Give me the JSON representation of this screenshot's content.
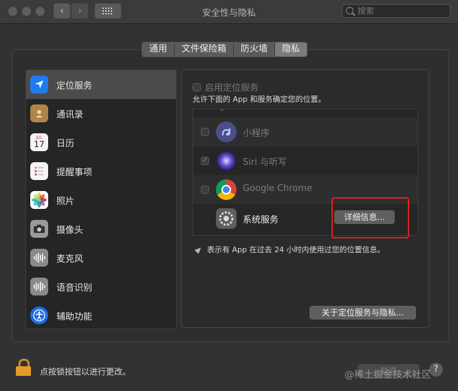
{
  "window": {
    "title": "安全性与隐私"
  },
  "search": {
    "placeholder": "搜索"
  },
  "tabs": [
    {
      "label": "通用"
    },
    {
      "label": "文件保险箱"
    },
    {
      "label": "防火墙"
    },
    {
      "label": "隐私"
    }
  ],
  "sidebar": {
    "items": [
      {
        "label": "定位服务",
        "icon": "location-arrow-icon",
        "color": "#1f7bf2"
      },
      {
        "label": "通讯录",
        "icon": "contacts-icon",
        "color": "#b08448"
      },
      {
        "label": "日历",
        "icon": "calendar-icon",
        "color": "#f4f4f4"
      },
      {
        "label": "提醒事项",
        "icon": "reminders-icon",
        "color": "#f5f5f5"
      },
      {
        "label": "照片",
        "icon": "photos-icon",
        "color": "#ffffff"
      },
      {
        "label": "摄像头",
        "icon": "camera-icon",
        "color": "#9a9a9a"
      },
      {
        "label": "麦克风",
        "icon": "microphone-icon",
        "color": "#8a8a8a"
      },
      {
        "label": "语音识别",
        "icon": "speech-recognition-icon",
        "color": "#8a8a8a"
      },
      {
        "label": "辅助功能",
        "icon": "accessibility-icon",
        "color": "#1a6ee6"
      }
    ]
  },
  "calendar_icon": {
    "month": "JUL",
    "day": "17"
  },
  "location": {
    "enable_label": "启用定位服务",
    "description": "允许下面的 App 和服务确定您的位置。",
    "apps": [
      {
        "name": "小程序",
        "checked": false,
        "icon": "mini-program-icon"
      },
      {
        "name": "Siri 与听写",
        "checked": true,
        "icon": "siri-icon"
      },
      {
        "name": "Google Chrome",
        "checked": false,
        "icon": "chrome-icon"
      },
      {
        "name": "系统服务",
        "icon": "system-services-gear-icon"
      }
    ],
    "detail_button": "详细信息...",
    "note": "表示有 App 在过去 24 小时内使用过您的位置信息。",
    "about_button": "关于定位服务与隐私..."
  },
  "footer": {
    "lock_text": "点按锁按钮以进行更改。",
    "revert_button": "复原",
    "help": "?"
  },
  "watermark": "@稀土掘金技术社区"
}
